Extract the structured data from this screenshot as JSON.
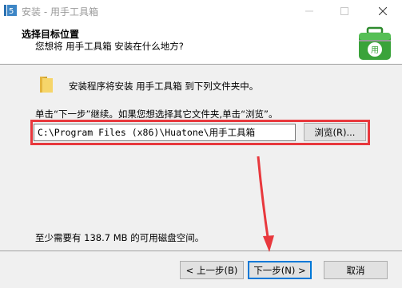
{
  "window": {
    "title": "安装 - 用手工具箱",
    "minimize_icon": "minimize-icon",
    "maximize_icon": "maximize-icon",
    "close_icon": "close-icon"
  },
  "header": {
    "title": "选择目标位置",
    "subtitle": "您想将 用手工具箱 安装在什么地方?",
    "icon": "toolbox-icon"
  },
  "main": {
    "intro": "安装程序将安装 用手工具箱 到下列文件夹中。",
    "instruction": "单击“下一步”继续。如果您想选择其它文件夹,单击“浏览”。",
    "path_value": "C:\\Program Files (x86)\\Huatone\\用手工具箱",
    "browse_label": "浏览(R)...",
    "space_required": "至少需要有 138.7 MB 的可用磁盘空间。"
  },
  "footer": {
    "back_label": "< 上一步(B)",
    "next_label": "下一步(N) >",
    "cancel_label": "取消"
  },
  "colors": {
    "highlight": "#e8383d",
    "arrow": "#e8383d",
    "folder": "#f2c84b",
    "toolbox_green": "#3aa33a"
  }
}
